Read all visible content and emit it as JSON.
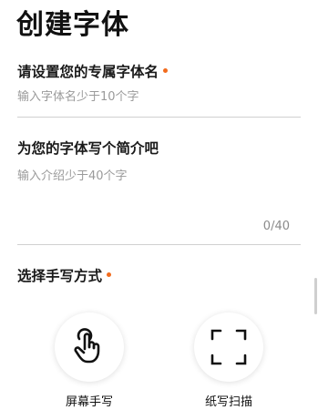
{
  "page": {
    "title": "创建字体"
  },
  "font_name": {
    "label": "请设置您的专属字体名",
    "placeholder": "输入字体名少于10个字"
  },
  "intro": {
    "label": "为您的字体写个简介吧",
    "placeholder": "输入介绍少于40个字",
    "counter": "0/40"
  },
  "method": {
    "label": "选择手写方式",
    "options": [
      {
        "label": "屏幕手写",
        "icon": "hand-touch-icon"
      },
      {
        "label": "纸写扫描",
        "icon": "scan-frame-icon"
      }
    ]
  },
  "colors": {
    "accent": "#f26b1d",
    "divider": "#d0d0d0"
  }
}
